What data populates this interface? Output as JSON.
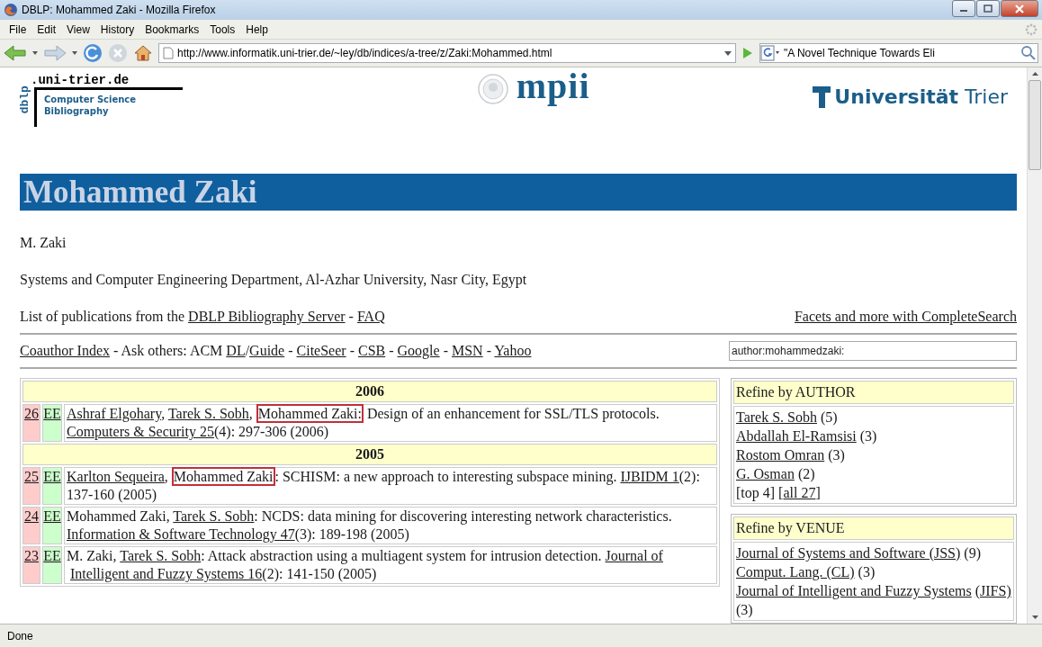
{
  "window": {
    "title": "DBLP: Mohammed Zaki - Mozilla Firefox"
  },
  "menu": [
    "File",
    "Edit",
    "View",
    "History",
    "Bookmarks",
    "Tools",
    "Help"
  ],
  "toolbar": {
    "url": "http://www.informatik.uni-trier.de/~ley/db/indices/a-tree/z/Zaki:Mohammed.html",
    "search": "\"A Novel Technique Towards Eli"
  },
  "page": {
    "dblp_logo": {
      "domain": ".uni-trier.de",
      "mark": "dblp",
      "line1": "Computer Science",
      "line2": "Bibliography"
    },
    "mpii_logo": "mpii",
    "uni_logo": "**Universität** Trier",
    "heading": "Mohammed Zaki",
    "alias": "M. Zaki",
    "affiliation": "Systems and Computer Engineering Department, Al-Azhar University, Nasr City, Egypt",
    "list_line": [
      {
        "kind": "plain",
        "text": "List of publications from the "
      },
      {
        "kind": "link",
        "text": "DBLP Bibliography Server"
      },
      {
        "kind": "plain",
        "text": " - "
      },
      {
        "kind": "link",
        "text": "FAQ"
      }
    ],
    "facets_link": "Facets and more with CompleteSearch",
    "links_line": [
      {
        "kind": "link",
        "text": "Coauthor Index"
      },
      {
        "kind": "plain",
        "text": " - Ask others: ACM "
      },
      {
        "kind": "link",
        "text": "DL"
      },
      {
        "kind": "plain",
        "text": "/"
      },
      {
        "kind": "link",
        "text": "Guide"
      },
      {
        "kind": "plain",
        "text": " - "
      },
      {
        "kind": "link",
        "text": "CiteSeer"
      },
      {
        "kind": "plain",
        "text": " - "
      },
      {
        "kind": "link",
        "text": "CSB"
      },
      {
        "kind": "plain",
        "text": " - "
      },
      {
        "kind": "link",
        "text": "Google"
      },
      {
        "kind": "plain",
        "text": " - "
      },
      {
        "kind": "link",
        "text": "MSN"
      },
      {
        "kind": "plain",
        "text": " - "
      },
      {
        "kind": "link",
        "text": "Yahoo"
      }
    ],
    "query": "author:mohammedzaki:",
    "publications": [
      {
        "kind": "year",
        "text": "2006"
      },
      {
        "kind": "entry",
        "number": "26",
        "ee": "EE",
        "segments": [
          {
            "kind": "link",
            "text": "Ashraf Elgohary"
          },
          {
            "kind": "plain",
            "text": ", "
          },
          {
            "kind": "link",
            "text": "Tarek S. Sobh"
          },
          {
            "kind": "plain",
            "text": ", "
          },
          {
            "kind": "highlight",
            "text": "Mohammed Zaki:"
          },
          {
            "kind": "plain",
            "text": " Design of an enhancement for SSL/TLS protocols. "
          },
          {
            "kind": "link",
            "text": "Computers & Security 25"
          },
          {
            "kind": "plain",
            "text": "(4): 297-306 (2006)"
          }
        ]
      },
      {
        "kind": "year",
        "text": "2005"
      },
      {
        "kind": "entry",
        "number": "25",
        "ee": "EE",
        "segments": [
          {
            "kind": "link",
            "text": "Karlton Sequeira"
          },
          {
            "kind": "plain",
            "text": ", "
          },
          {
            "kind": "highlight",
            "text": "Mohammed Zaki"
          },
          {
            "kind": "plain",
            "text": ": SCHISM: a new approach to interesting subspace mining. "
          },
          {
            "kind": "link",
            "text": "IJBIDM 1"
          },
          {
            "kind": "plain",
            "text": "(2): 137-160 (2005)"
          }
        ]
      },
      {
        "kind": "entry",
        "number": "24",
        "ee": "EE",
        "segments": [
          {
            "kind": "plain",
            "text": "Mohammed Zaki, "
          },
          {
            "kind": "link",
            "text": "Tarek S. Sobh"
          },
          {
            "kind": "plain",
            "text": ": NCDS: data mining for discovering interesting network characteristics. "
          },
          {
            "kind": "link",
            "text": "Information & Software Technology 47"
          },
          {
            "kind": "plain",
            "text": "(3): 189-198 (2005)"
          }
        ]
      },
      {
        "kind": "entry",
        "number": "23",
        "ee": "EE",
        "segments": [
          {
            "kind": "plain",
            "text": "M. Zaki, "
          },
          {
            "kind": "link",
            "text": "Tarek S. Sobh"
          },
          {
            "kind": "plain",
            "text": ": Attack abstraction using a multiagent system for intrusion detection. "
          },
          {
            "kind": "link",
            "text": "Journal of"
          },
          {
            "kind": "link",
            "text": "Intelligent and Fuzzy Systems 16"
          },
          {
            "kind": "plain",
            "text": "(2): 141-150 (2005)"
          }
        ]
      }
    ],
    "sidebar": [
      {
        "title": "Refine by AUTHOR",
        "items": [
          [
            {
              "kind": "link",
              "text": "Tarek S. Sobh"
            },
            {
              "kind": "plain",
              "text": " (5)"
            }
          ],
          [
            {
              "kind": "link",
              "text": "Abdallah El-Ramsisi"
            },
            {
              "kind": "plain",
              "text": " (3)"
            }
          ],
          [
            {
              "kind": "link",
              "text": "Rostom Omran"
            },
            {
              "kind": "plain",
              "text": " (3)"
            }
          ],
          [
            {
              "kind": "link",
              "text": "G. Osman"
            },
            {
              "kind": "plain",
              "text": " (2)"
            }
          ],
          [
            {
              "kind": "plain",
              "text": "[top 4] ["
            },
            {
              "kind": "link",
              "text": "all 27"
            },
            {
              "kind": "plain",
              "text": "]"
            }
          ]
        ]
      },
      {
        "title": "Refine by VENUE",
        "items": [
          [
            {
              "kind": "link",
              "text": "Journal of Systems and Software (JSS)"
            },
            {
              "kind": "plain",
              "text": " (9)"
            }
          ],
          [
            {
              "kind": "link",
              "text": "Comput. Lang. (CL)"
            },
            {
              "kind": "plain",
              "text": " (3)"
            }
          ],
          [
            {
              "kind": "link",
              "text": "Journal of Intelligent and Fuzzy Systems"
            },
            {
              "kind": "link",
              "text": "(JIFS)"
            },
            {
              "kind": "plain",
              "text": " (3)"
            }
          ]
        ]
      }
    ]
  },
  "status_bar": "Done"
}
